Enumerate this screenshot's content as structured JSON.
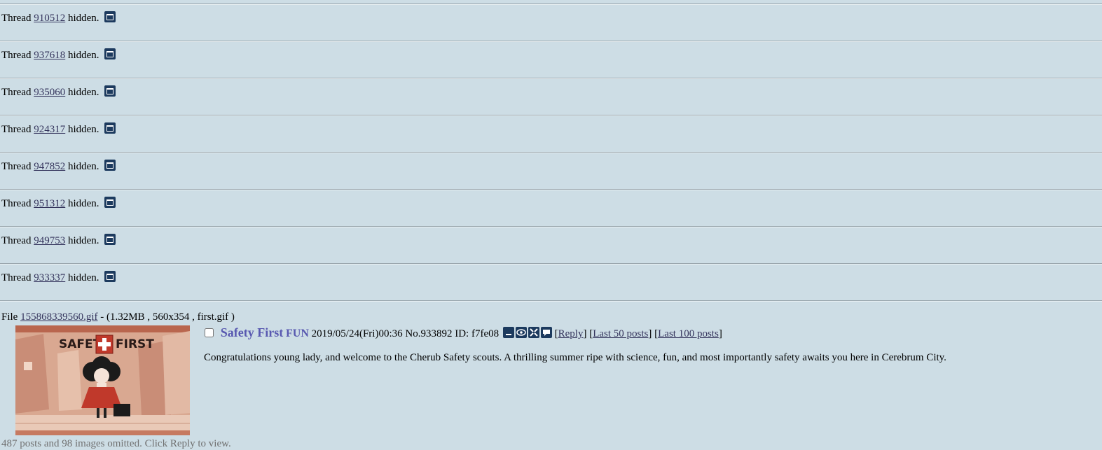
{
  "hidden_threads": [
    {
      "prefix": "Thread",
      "id": "910512",
      "suffix": "hidden."
    },
    {
      "prefix": "Thread",
      "id": "937618",
      "suffix": "hidden."
    },
    {
      "prefix": "Thread",
      "id": "935060",
      "suffix": "hidden."
    },
    {
      "prefix": "Thread",
      "id": "924317",
      "suffix": "hidden."
    },
    {
      "prefix": "Thread",
      "id": "947852",
      "suffix": "hidden."
    },
    {
      "prefix": "Thread",
      "id": "951312",
      "suffix": "hidden."
    },
    {
      "prefix": "Thread",
      "id": "949753",
      "suffix": "hidden."
    },
    {
      "prefix": "Thread",
      "id": "933337",
      "suffix": "hidden."
    }
  ],
  "op": {
    "file_prefix": "File",
    "file_name": "155868339560.gif",
    "file_info": "- (1.32MB , 560x354 , first.gif )",
    "thumb_text_left": "SAFETY",
    "thumb_text_right": "FIRST",
    "subject": "Safety First",
    "name": "FUN",
    "date": "2019/05/24(Fri)00:36",
    "no_label": "No.",
    "no": "933892",
    "id_label": "ID:",
    "id": "f7fe08",
    "icons": [
      "hide-icon",
      "watch-icon",
      "expand-icon",
      "reply-icon"
    ],
    "reply_label": "Reply",
    "last50_label": "Last 50 posts",
    "last100_label": "Last 100 posts",
    "message": "Congratulations young lady, and welcome to the Cherub Safety scouts. A thrilling summer ripe with science, fun, and most importantly safety awaits you here in Cerebrum City.",
    "omitted": "487 posts and 98 images omitted. Click Reply to view."
  },
  "colors": {
    "background": "#cddde5",
    "link": "#34345c",
    "subject": "#5858b0",
    "icon": "#1c3a5e"
  }
}
